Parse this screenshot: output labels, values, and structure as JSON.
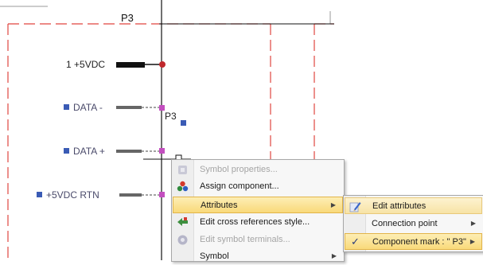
{
  "part": {
    "title": "P3",
    "ref": "P3"
  },
  "pins": [
    {
      "number": "1",
      "name": "+5VDC"
    },
    {
      "name": "DATA -"
    },
    {
      "name": "DATA +"
    },
    {
      "name": "+5VDC RTN"
    }
  ],
  "colors": {
    "border_dash": "#e0453f",
    "wire": "#111111",
    "node_red": "#c0282c",
    "node_magenta": "#c34fbf",
    "pin_blue": "#3a5bb5",
    "menu_highlight": "#f9d97a"
  },
  "context_menu": {
    "items": [
      {
        "label": "Symbol properties...",
        "icon": "properties-icon",
        "disabled": true
      },
      {
        "label": "Assign component...",
        "icon": "assign-component-icon",
        "disabled": false
      },
      {
        "label": "Attributes",
        "icon": "",
        "disabled": false,
        "submenu": true,
        "highlighted": true
      },
      {
        "label": "Edit cross references style...",
        "icon": "cross-reference-icon",
        "disabled": false
      },
      {
        "label": "Edit symbol terminals...",
        "icon": "terminals-icon",
        "disabled": true
      },
      {
        "label": "Symbol",
        "icon": "",
        "disabled": false,
        "submenu": true
      }
    ]
  },
  "attributes_submenu": {
    "items": [
      {
        "label": "Edit attributes",
        "icon": "edit-pencil-icon"
      },
      {
        "label": "Connection point",
        "submenu": true
      },
      {
        "label": "Component mark : \" P3\"",
        "checked": true,
        "submenu": true,
        "highlighted": true
      }
    ]
  }
}
